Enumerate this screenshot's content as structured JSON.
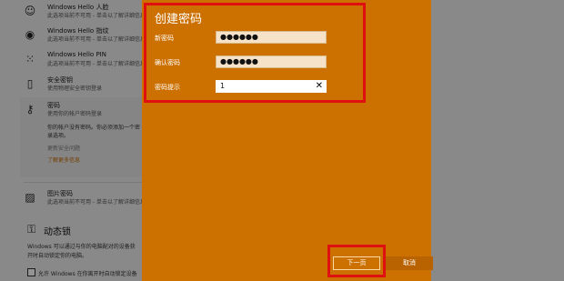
{
  "settings": {
    "items": [
      {
        "icon": "smiley-face-icon",
        "glyph": "☺",
        "title": "Windows Hello 人脸",
        "desc": "此选项当前不可用 - 单击以了解详细信息"
      },
      {
        "icon": "fingerprint-icon",
        "glyph": "◉",
        "title": "Windows Hello 指纹",
        "desc": "此选项当前不可用 - 单击以了解详细信息"
      },
      {
        "icon": "pin-keypad-icon",
        "glyph": "⁙",
        "title": "Windows Hello PIN",
        "desc": "此选项当前不可用 - 单击以了解详细信息"
      },
      {
        "icon": "security-key-icon",
        "glyph": "▯",
        "title": "安全密钥",
        "desc": "使用物理安全密钥登录"
      },
      {
        "icon": "key-icon",
        "glyph": "⚷",
        "title": "密码",
        "desc": "使用你的帐户密码登录"
      }
    ],
    "password_para_1": "你的帐户没有密码。你必须添加一个密",
    "password_para_2": "录选项。",
    "secondary_text": "更新安全问题",
    "learn_more": "了解更多信息",
    "picture_password": {
      "icon": "picture-icon",
      "glyph": "▨",
      "title": "图片密码",
      "desc": "此选项当前不可用 - 单击以了解详细信息"
    },
    "dynamic_lock": {
      "icon": "dynamic-lock-icon",
      "glyph": "⚿",
      "title": "动态锁"
    },
    "dynamic_lock_para_1": "Windows 可以通过与你的电脑配对的设备获",
    "dynamic_lock_para_2": "开时自动锁定你的电脑。",
    "dynamic_lock_checkbox": "允许 Windows 在你离开时自动锁定设备"
  },
  "dialog": {
    "title": "创建密码",
    "fields": [
      {
        "label": "新密码",
        "value": "●●●●●●"
      },
      {
        "label": "确认密码",
        "value": "●●●●●●"
      },
      {
        "label": "密码提示",
        "value": "1"
      }
    ],
    "clear_glyph": "✕",
    "next_button": "下一页",
    "cancel_button": "取消"
  },
  "colors": {
    "dialog_bg": "#cc7000",
    "highlight": "#e01010",
    "link": "#c86a00"
  }
}
